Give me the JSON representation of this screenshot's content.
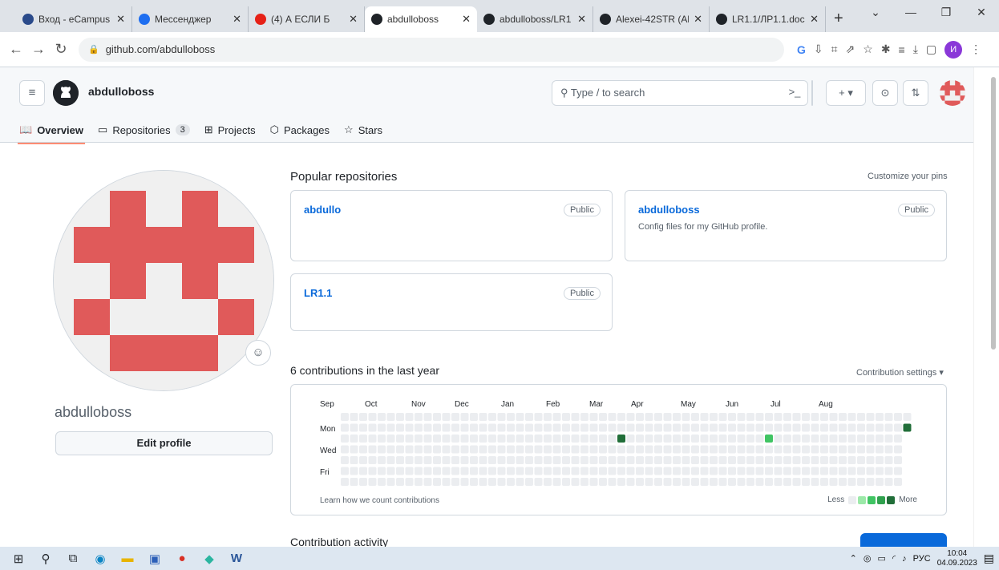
{
  "browser": {
    "tabs": [
      {
        "label": "Вход - eCampus",
        "color": "#2a4a8a"
      },
      {
        "label": "Мессенджер",
        "color": "#1e6ef0"
      },
      {
        "label": "(4) А ЕСЛИ Б",
        "color": "#e62117"
      },
      {
        "label": "abdulloboss",
        "color": "#1f2328"
      },
      {
        "label": "abdulloboss/LR1",
        "color": "#1f2328"
      },
      {
        "label": "Alexei-42STR (Al",
        "color": "#1f2328"
      },
      {
        "label": "LR1.1/ЛР1.1.doc",
        "color": "#1f2328"
      }
    ],
    "new_tab": "+",
    "url": "github.com/abdulloboss",
    "profile_letter": "И"
  },
  "header": {
    "username": "abdulloboss",
    "search_placeholder": "Type / to search",
    "terminal": ">_",
    "plus": "+ ▾"
  },
  "nav": {
    "overview": "Overview",
    "repositories": "Repositories",
    "repo_count": "3",
    "projects": "Projects",
    "packages": "Packages",
    "stars": "Stars"
  },
  "profile": {
    "name": "abdulloboss",
    "edit": "Edit profile",
    "avatar_color": "#e05a5a"
  },
  "popular": {
    "title": "Popular repositories",
    "customize": "Customize your pins",
    "repos": [
      {
        "name": "abdullo",
        "visibility": "Public",
        "desc": ""
      },
      {
        "name": "abdulloboss",
        "visibility": "Public",
        "desc": "Config files for my GitHub profile."
      },
      {
        "name": "LR1.1",
        "visibility": "Public",
        "desc": ""
      }
    ]
  },
  "contributions": {
    "title": "6 contributions in the last year",
    "settings": "Contribution settings ▾",
    "months": [
      "Sep",
      "Oct",
      "Nov",
      "Dec",
      "Jan",
      "Feb",
      "Mar",
      "Apr",
      "May",
      "Jun",
      "Jul",
      "Aug"
    ],
    "days": [
      "Mon",
      "Wed",
      "Fri"
    ],
    "learn": "Learn how we count contributions",
    "less": "Less",
    "more": "More",
    "legend_colors": [
      "#ebedf0",
      "#9be9a8",
      "#40c463",
      "#30a14e",
      "#216e39"
    ]
  },
  "activity": {
    "title": "Contribution activity"
  },
  "taskbar": {
    "lang": "РУС",
    "time": "10:04",
    "date": "04.09.2023"
  }
}
